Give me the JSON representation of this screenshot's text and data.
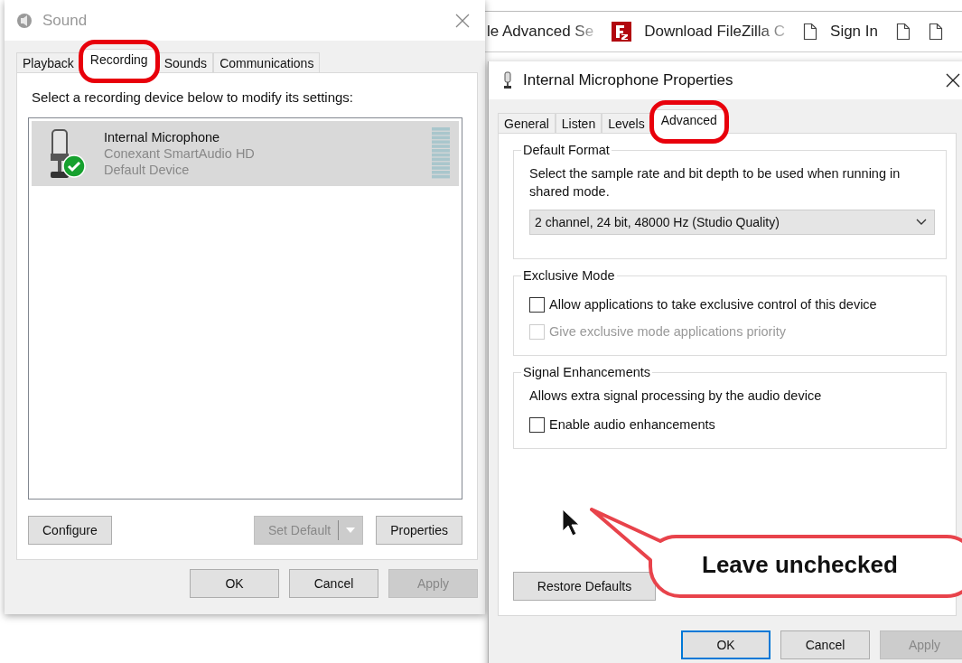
{
  "browser_bookmarks": [
    {
      "label": "le Advanced Se",
      "kind": "text",
      "faded": true
    },
    {
      "label": "Download FileZilla C",
      "kind": "filezilla",
      "faded": true
    },
    {
      "label": "Sign In",
      "kind": "page",
      "faded": false
    },
    {
      "kind": "page"
    },
    {
      "kind": "page"
    }
  ],
  "sound_window": {
    "title": "Sound",
    "tabs": [
      {
        "label": "Playback",
        "selected": false,
        "highlighted": false
      },
      {
        "label": "Recording",
        "selected": true,
        "highlighted": true
      },
      {
        "label": "Sounds",
        "selected": false,
        "highlighted": false
      },
      {
        "label": "Communications",
        "selected": false,
        "highlighted": false
      }
    ],
    "instruction": "Select a recording device below to modify its settings:",
    "devices": [
      {
        "name": "Internal Microphone",
        "driver": "Conexant SmartAudio HD",
        "status": "Default Device",
        "selected": true,
        "is_default": true
      }
    ],
    "buttons": [
      {
        "label": "Configure",
        "disabled": false,
        "split": false
      },
      {
        "label": "Set Default",
        "disabled": true,
        "split": true
      },
      {
        "label": "Properties",
        "disabled": false,
        "split": false
      }
    ],
    "dialog_buttons": [
      {
        "label": "OK",
        "disabled": false,
        "default": false
      },
      {
        "label": "Cancel",
        "disabled": false,
        "default": false
      },
      {
        "label": "Apply",
        "disabled": true,
        "default": false
      }
    ]
  },
  "properties_dialog": {
    "title": "Internal Microphone Properties",
    "tabs": [
      {
        "label": "General",
        "selected": false,
        "highlighted": false
      },
      {
        "label": "Listen",
        "selected": false,
        "highlighted": false
      },
      {
        "label": "Levels",
        "selected": false,
        "highlighted": false
      },
      {
        "label": "Advanced",
        "selected": true,
        "highlighted": true
      }
    ],
    "sections": [
      {
        "title": "Default Format",
        "description": "Select the sample rate and bit depth to be used when running in shared mode.",
        "dropdown": "2 channel, 24 bit, 48000 Hz (Studio Quality)"
      },
      {
        "title": "Exclusive Mode",
        "options": [
          {
            "label": "Allow applications to take exclusive control of this device",
            "checked": false,
            "disabled": false
          },
          {
            "label": "Give exclusive mode applications priority",
            "checked": false,
            "disabled": true
          }
        ]
      },
      {
        "title": "Signal Enhancements",
        "description": "Allows extra signal processing by the audio device",
        "options": [
          {
            "label": "Enable audio enhancements",
            "checked": false,
            "disabled": false
          }
        ]
      }
    ],
    "restore_button": "Restore Defaults",
    "dialog_buttons": [
      {
        "label": "OK",
        "disabled": false,
        "default": true
      },
      {
        "label": "Cancel",
        "disabled": false,
        "default": false
      },
      {
        "label": "Apply",
        "disabled": true,
        "default": false
      }
    ]
  },
  "callout": {
    "text": "Leave unchecked"
  }
}
